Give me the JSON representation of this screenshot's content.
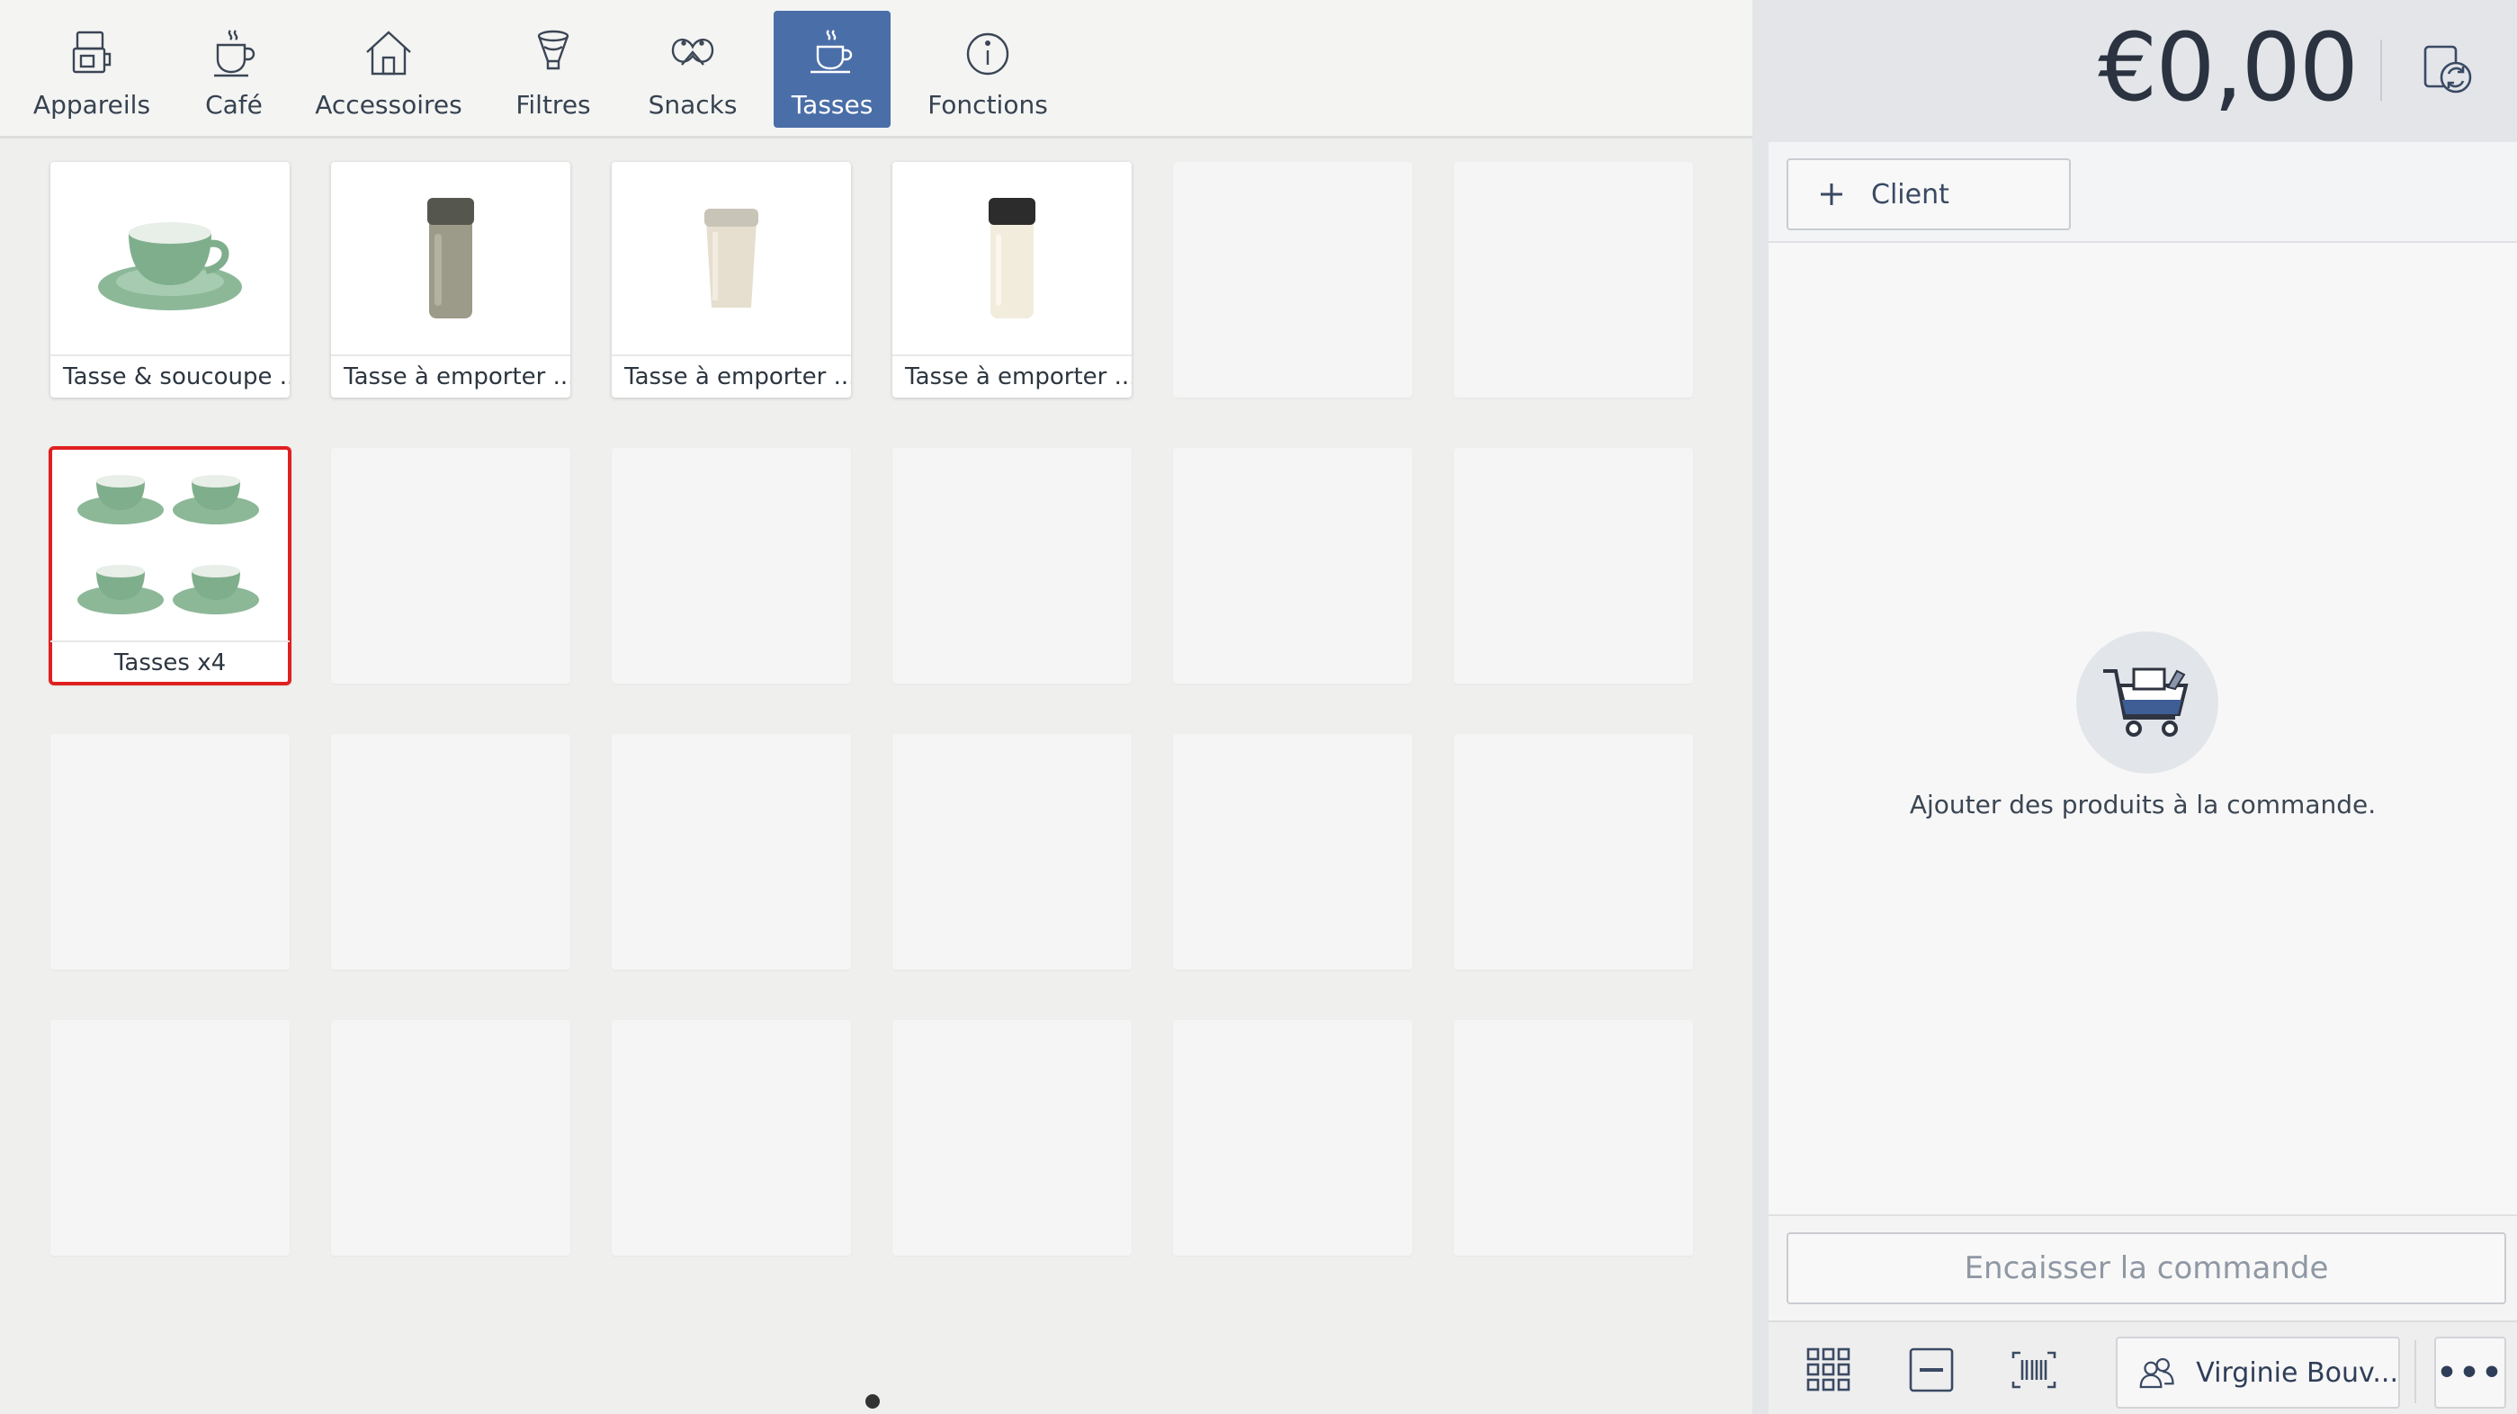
{
  "tabs": [
    {
      "label": "Appareils",
      "icon": "device-icon",
      "active": false
    },
    {
      "label": "Café",
      "icon": "coffee-cup-icon",
      "active": false
    },
    {
      "label": "Accessoires",
      "icon": "house-icon",
      "active": false
    },
    {
      "label": "Filtres",
      "icon": "filter-icon",
      "active": false
    },
    {
      "label": "Snacks",
      "icon": "pretzel-icon",
      "active": false
    },
    {
      "label": "Tasses",
      "icon": "cup-icon",
      "active": true
    },
    {
      "label": "Fonctions",
      "icon": "info-icon",
      "active": false
    }
  ],
  "products": [
    {
      "name": "Tasse & soucoupe ...",
      "image": "green-cup-saucer"
    },
    {
      "name": "Tasse à emporter ...",
      "image": "khaki-tumbler"
    },
    {
      "name": "Tasse à emporter ...",
      "image": "white-travel-cup"
    },
    {
      "name": "Tasse à emporter ...",
      "image": "cream-tumbler"
    },
    {
      "name": "Tasses x4",
      "image": "four-green-cups",
      "selected": true
    }
  ],
  "order": {
    "total": "€0,00",
    "client_label": "Client",
    "empty_message": "Ajouter des produits à la commande.",
    "checkout_label": "Encaisser la commande",
    "user_name": "Virginie Bouv...",
    "more_label": "•••"
  },
  "colors": {
    "accent": "#4a6ea8",
    "selection": "#e02020",
    "cup_green": "#7fae8c"
  }
}
